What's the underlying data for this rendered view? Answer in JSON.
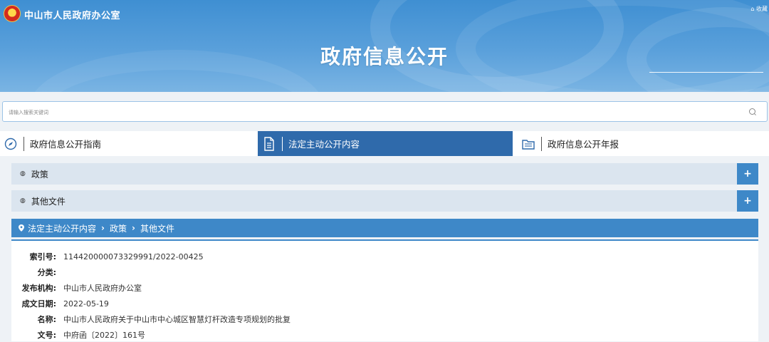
{
  "header": {
    "org_name": "中山市人民政府办公室",
    "top_link": "⌂ 收藏",
    "page_title": "政府信息公开"
  },
  "search": {
    "placeholder": "请输入搜索关键词"
  },
  "tabs": [
    {
      "label": "政府信息公开指南",
      "icon": "compass-icon"
    },
    {
      "label": "法定主动公开内容",
      "icon": "document-icon",
      "active": true
    },
    {
      "label": "政府信息公开年报",
      "icon": "folder-icon"
    }
  ],
  "accordion": [
    {
      "label": "政策",
      "toggle": "+"
    },
    {
      "label": "其他文件",
      "toggle": "+"
    }
  ],
  "breadcrumb": {
    "items": [
      "法定主动公开内容",
      "政策",
      "其他文件"
    ]
  },
  "detail": {
    "fields": [
      {
        "key": "索引号:",
        "value": "114420000073329991/2022-00425"
      },
      {
        "key": "分类:",
        "value": ""
      },
      {
        "key": "发布机构:",
        "value": "中山市人民政府办公室"
      },
      {
        "key": "成文日期:",
        "value": "2022-05-19"
      },
      {
        "key": "名称:",
        "value": "中山市人民政府关于中山市中心城区智慧灯杆改造专项规划的批复"
      },
      {
        "key": "文号:",
        "value": "中府函〔2022〕161号"
      }
    ]
  },
  "colors": {
    "banner": "#4a94d6",
    "active_tab": "#2f6aab",
    "accent": "#3e88c8",
    "accordion_bg": "#dbe5ef"
  }
}
